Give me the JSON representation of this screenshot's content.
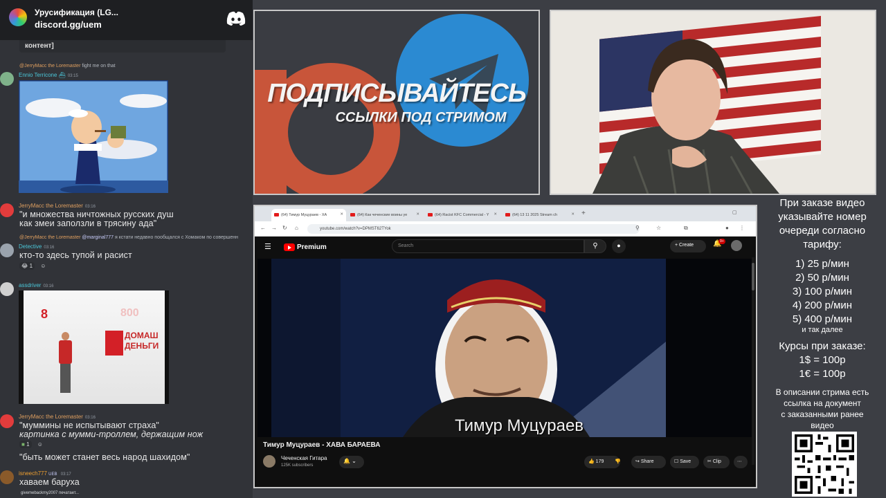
{
  "discord": {
    "server_name": "Урусификация (LG...",
    "invite": "discord.gg/uem",
    "truncated_top": "контент]",
    "messages": [
      {
        "reply_name": "@JerryMacc the Loremaster",
        "reply_text": "fight me on that",
        "user": "Ennio Terricone",
        "time": "03:15",
        "user_color": "#4bc7d9"
      },
      {
        "user": "JerryMacc the Loremaster",
        "time": "03:16",
        "user_color": "#e0a060",
        "lines": [
          "\"и множества ничтожных русских душ",
          "как змеи заползли в трясину ада\""
        ]
      },
      {
        "reply_name": "@JerryMacc the Loremaster",
        "reply_mention": "@marginal777",
        "reply_text": "я кстати недавно пообщался с Хомаком по совершенн",
        "user": "Detective",
        "time": "03:16",
        "user_color": "#4bc7d9",
        "lines": [
          "кто-то здесь тупой и расист"
        ],
        "reaction": "1"
      },
      {
        "user": "assdriver",
        "time": "03:16",
        "user_color": "#4bc7d9",
        "image_text": {
          "number": "8",
          "code": "800",
          "brand_line1": "ДОМАШ",
          "brand_line2": "ДЕНЬГИ"
        }
      },
      {
        "user": "JerryMacc the Loremaster",
        "time": "03:16",
        "user_color": "#e0a060",
        "lines": [
          "\"муммины не испытывают страха\"",
          "картинка с мумми-троллем, держащим нож",
          "\"быть может станет весь народ шахидом\""
        ],
        "reaction": "1"
      },
      {
        "user": "isneech777",
        "badge": "UEB",
        "time": "03:17",
        "user_color": "#f0a030",
        "lines": [
          "хаваем баруха"
        ]
      }
    ],
    "typing": "givemebackmy2007 печатает..."
  },
  "promo": {
    "title": "ПОДПИСЫВАЙТЕСЬ",
    "subtitle": "ССЫЛКИ ПОД СТРИМОМ"
  },
  "browser": {
    "tabs": [
      "(64) Тимур Муцураев - ХА",
      "(64) Как чеченские воины уе",
      "(64) Racist KFC Commercial - Y",
      "(64) 13 11 2025 Stream ch"
    ],
    "url": "youtube.com/watch?v=DPMST62TYok",
    "youtube": {
      "brand": "Premium",
      "search_placeholder": "Search",
      "create_label": "Create",
      "notification_badge": "9+",
      "video_caption": "Тимур Муцураев",
      "video_title": "Тимур Муцураев - ХАВА БАРАЕВА",
      "channel_name": "Чеченская Гитара",
      "channel_subs": "125K subscribers",
      "likes": "179",
      "share_label": "Share",
      "save_label": "Save",
      "clip_label": "Clip"
    }
  },
  "info_panel": {
    "heading": [
      "При заказе видео",
      "указывайте номер",
      "очереди согласно",
      "тарифу:"
    ],
    "tariffs": [
      "1) 25 р/мин",
      "2) 50 р/мин",
      "3) 100 р/мин",
      "4) 200 р/мин",
      "5) 400 р/мин"
    ],
    "etc": "и так далее",
    "rates_title": "Курсы при заказе:",
    "rates": [
      "1$ = 100р",
      "1€ = 100р"
    ],
    "description": [
      "В описании стрима есть",
      "ссылка на документ",
      "с заказанными ранее",
      "видео"
    ]
  },
  "colors": {
    "discord_bg": "#313338",
    "youtube_red": "#ff0000",
    "telegram_blue": "#2b8ad2",
    "patreon_orange": "#c8553a"
  }
}
